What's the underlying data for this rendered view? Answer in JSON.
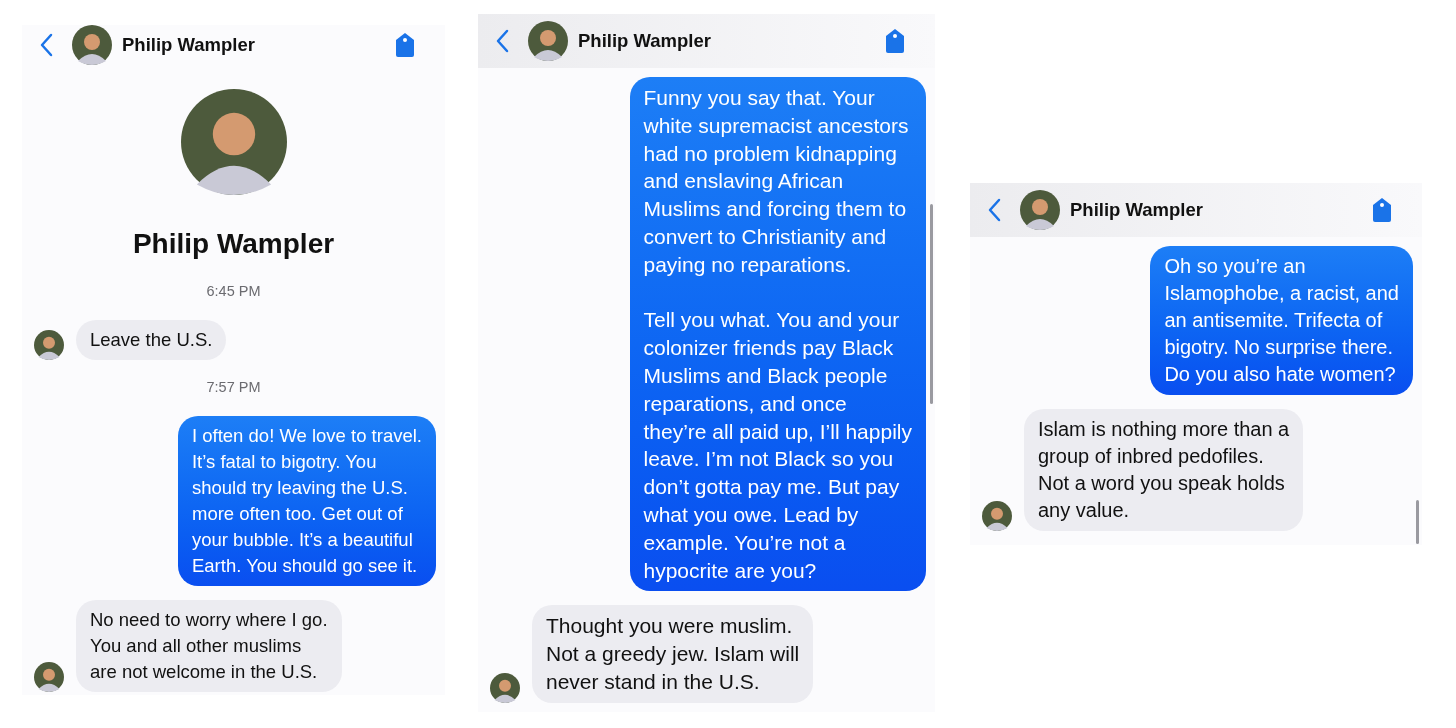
{
  "panels": [
    {
      "header": {
        "name": "Philip Wampler"
      },
      "profile": {
        "name": "Philip Wampler"
      },
      "messages": [
        {
          "kind": "timestamp",
          "text": "6:45 PM"
        },
        {
          "kind": "incoming",
          "text": "Leave the U.S."
        },
        {
          "kind": "timestamp",
          "text": "7:57 PM"
        },
        {
          "kind": "outgoing",
          "text": "I often do! We love to travel.\nIt’s fatal to bigotry. You\nshould try leaving the U.S.\nmore often too. Get out of\nyour bubble. It’s a beautiful\nEarth. You should go see it."
        },
        {
          "kind": "incoming",
          "text": "No need to worry where I go.\nYou and all other muslims\nare not welcome in the U.S."
        }
      ]
    },
    {
      "header": {
        "name": "Philip Wampler"
      },
      "messages": [
        {
          "kind": "outgoing",
          "text": "Funny you say that. Your\nwhite supremacist ancestors\nhad no problem kidnapping\nand enslaving African\nMuslims and forcing them to\nconvert to Christianity and\npaying no reparations.\n\nTell you what. You and your\ncolonizer friends pay Black\nMuslims and Black people\nreparations, and once\nthey’re all paid up, I’ll happily\nleave. I’m not Black so you\ndon’t gotta pay me. But pay\nwhat you owe. Lead by\nexample. You’re not a\nhypocrite are you?"
        },
        {
          "kind": "incoming",
          "text": "Thought you were muslim.\nNot a greedy jew.  Islam will\nnever stand in the U.S."
        }
      ]
    },
    {
      "header": {
        "name": "Philip Wampler"
      },
      "messages": [
        {
          "kind": "outgoing",
          "text": "Oh so you’re an\nIslamophobe, a racist, and\nan antisemite. Trifecta of\nbigotry. No surprise there.\nDo you also hate women?"
        },
        {
          "kind": "incoming",
          "text": "Islam is nothing more than a\ngroup of inbred pedofiles.\nNot a word you speak holds\nany value."
        }
      ]
    }
  ]
}
